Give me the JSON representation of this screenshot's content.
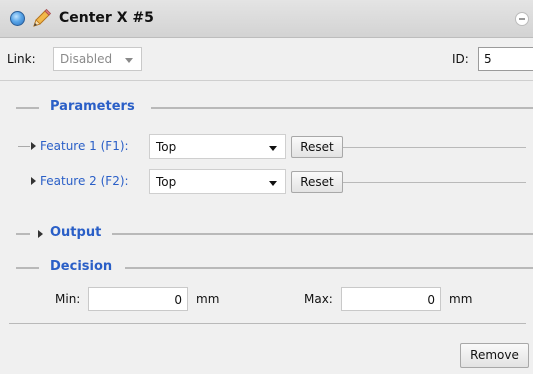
{
  "window": {
    "title": "Center X #5"
  },
  "link": {
    "label": "Link:",
    "value": "Disabled"
  },
  "id": {
    "label": "ID:",
    "value": "5"
  },
  "sections": {
    "parameters": "Parameters",
    "output": "Output",
    "decision": "Decision"
  },
  "features": [
    {
      "label": "Feature 1 (F1):",
      "value": "Top",
      "reset_label": "Reset"
    },
    {
      "label": "Feature 2 (F2):",
      "value": "Top",
      "reset_label": "Reset"
    }
  ],
  "decision": {
    "min_label": "Min:",
    "min_value": "0",
    "min_unit": "mm",
    "max_label": "Max:",
    "max_value": "0",
    "max_unit": "mm"
  },
  "actions": {
    "remove_label": "Remove"
  },
  "colors": {
    "section_accent": "#2a5fc7",
    "title_bar": "#d8d8d8",
    "panel_bg": "#f0f0f0"
  },
  "icons": {
    "status": "blue-orb-icon",
    "edit": "pencil-icon",
    "collapse": "minus-circle-icon",
    "expand": "triangle-right-icon",
    "dropdown": "chevron-down-icon"
  }
}
